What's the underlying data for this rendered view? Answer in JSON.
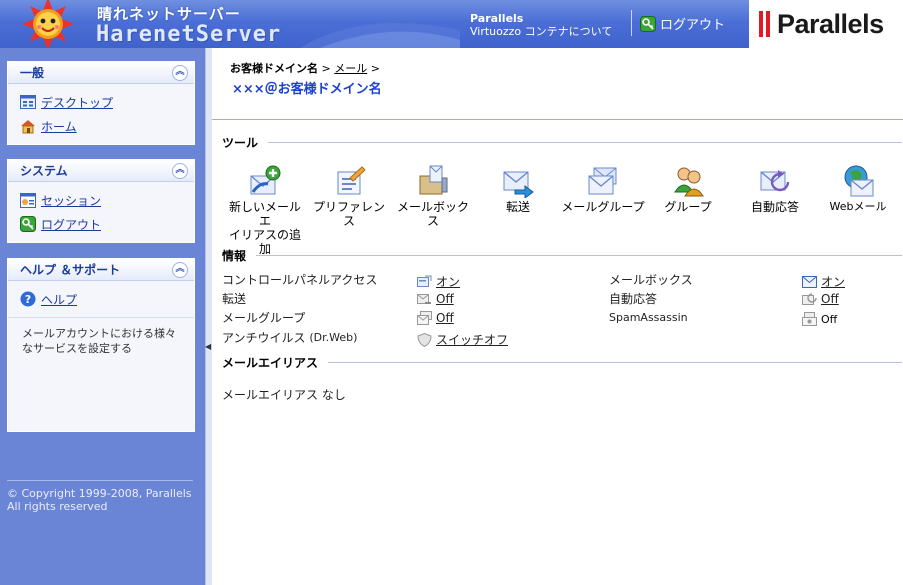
{
  "header": {
    "brand_jp": "晴れネットサーバー",
    "brand_en": "HarenetServer",
    "about_line1": "Parallels",
    "about_line2": "Virtuozzo コンテナについて",
    "logout": "ログアウト",
    "vendor": "Parallels"
  },
  "sidebar": {
    "panels": [
      {
        "title": "一般",
        "items": [
          "デスクトップ",
          "ホーム"
        ]
      },
      {
        "title": "システム",
        "items": [
          "セッション",
          "ログアウト"
        ]
      },
      {
        "title": "ヘルプ ＆サポート",
        "items": [
          "ヘルプ"
        ],
        "description": "メールアカウントにおける様々なサービスを設定する"
      }
    ],
    "copyright_line1": "© Copyright 1999-2008, Parallels",
    "copyright_line2": "All rights reserved"
  },
  "breadcrumb": {
    "domain": "お客様ドメイン名",
    "sep1": " > ",
    "mail": "メール",
    "sep2": " >"
  },
  "page_title": "×××＠お客様ドメイン名",
  "tools": {
    "heading": "ツール",
    "items": [
      {
        "label_line1": "新しいメールエ",
        "label_line2": "イリアスの追加"
      },
      {
        "label_line1": "プリファレンス"
      },
      {
        "label_line1": "メールボックス"
      },
      {
        "label_line1": "転送"
      },
      {
        "label_line1": "メールグループ"
      },
      {
        "label_line1": "グループ"
      },
      {
        "label_line1": "自動応答"
      },
      {
        "label_line1": "Webメール"
      }
    ]
  },
  "info": {
    "heading": "情報",
    "left": [
      {
        "label": "コントロールパネルアクセス",
        "status": "オン"
      },
      {
        "label": "転送",
        "status": "Off"
      },
      {
        "label": "メールグループ",
        "status": "Off"
      },
      {
        "label": "アンチウイルス",
        "label_suffix": "(Dr.Web)",
        "status": "スイッチオフ"
      }
    ],
    "right": [
      {
        "label": "メールボックス",
        "status": "オン"
      },
      {
        "label": "自動応答",
        "status": "Off"
      },
      {
        "label": "SpamAssassin",
        "status": "Off"
      }
    ]
  },
  "aliases": {
    "heading": "メールエイリアス",
    "empty": "メールエイリアス なし"
  }
}
